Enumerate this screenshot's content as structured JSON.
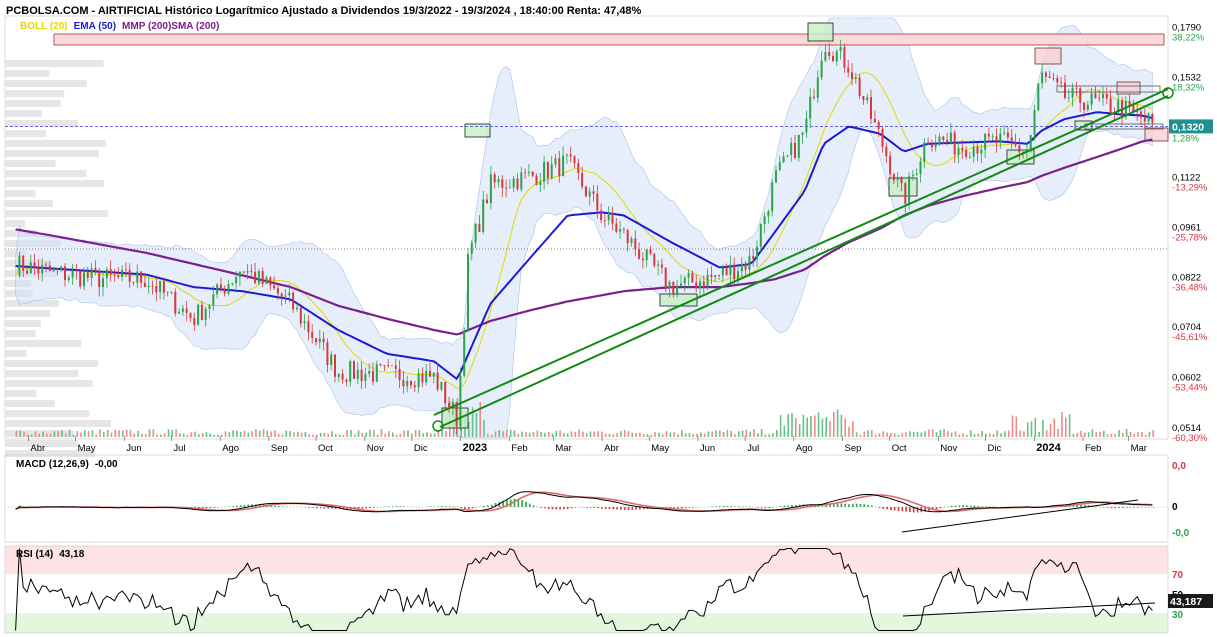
{
  "header": {
    "title": "PCBOLSA.COM - AIRTIFICIAL Histórico Logarítmico Ajustado a Dividendos 19/3/2022 - 19/3/2024 , 18:40:00 Renta: 47,48%"
  },
  "legend": {
    "boll": "BOLL (20)",
    "ema": "EMA (50)",
    "mmp_sma": "MMP (200)SMA (200)",
    "colors": {
      "boll": "#e3d800",
      "ema": "#1b1bd6",
      "mmp": "#7a1f8c",
      "sma": "#7a1f8c"
    }
  },
  "price_axis": {
    "labels": [
      {
        "price": "0,1790",
        "pct": "38,22%"
      },
      {
        "price": "0,1532",
        "pct": "18,32%"
      },
      {
        "price": "0,1122",
        "pct": "-13,29%"
      },
      {
        "price": "0,0961",
        "pct": "-25,78%"
      },
      {
        "price": "0,0822",
        "pct": "-36,48%"
      },
      {
        "price": "0,0704",
        "pct": "-45,61%"
      },
      {
        "price": "0,0602",
        "pct": "-53,44%"
      },
      {
        "price": "0,0514",
        "pct": "-60,30%"
      }
    ],
    "current_price": "0,1320",
    "current_pct_partial": "1,28%"
  },
  "months": [
    {
      "label": "Abr",
      "bold": false
    },
    {
      "label": "May",
      "bold": false
    },
    {
      "label": "Jun",
      "bold": false
    },
    {
      "label": "Jul",
      "bold": false
    },
    {
      "label": "Ago",
      "bold": false
    },
    {
      "label": "Sep",
      "bold": false
    },
    {
      "label": "Oct",
      "bold": false
    },
    {
      "label": "Nov",
      "bold": false
    },
    {
      "label": "Dic",
      "bold": false
    },
    {
      "label": "2023",
      "bold": true
    },
    {
      "label": "Feb",
      "bold": false
    },
    {
      "label": "Mar",
      "bold": false
    },
    {
      "label": "Abr",
      "bold": false
    },
    {
      "label": "May",
      "bold": false
    },
    {
      "label": "Jun",
      "bold": false
    },
    {
      "label": "Jul",
      "bold": false
    },
    {
      "label": "Ago",
      "bold": false
    },
    {
      "label": "Sep",
      "bold": false
    },
    {
      "label": "Oct",
      "bold": false
    },
    {
      "label": "Nov",
      "bold": false
    },
    {
      "label": "Dic",
      "bold": false
    },
    {
      "label": "2024",
      "bold": true
    },
    {
      "label": "Feb",
      "bold": false
    },
    {
      "label": "Mar",
      "bold": false
    }
  ],
  "macd": {
    "title": "MACD (12,26,9)",
    "value": "-0,00",
    "axis": [
      "0,0",
      "0",
      "-0,0"
    ]
  },
  "rsi": {
    "title": "RSI (14)",
    "value": "43,18",
    "axis": [
      "70",
      "50",
      "30"
    ],
    "current": "43,187"
  },
  "chart_data": {
    "type": "line",
    "scale": "log",
    "x": [
      "2022-03-21",
      "2022-04-15",
      "2022-05-15",
      "2022-06-15",
      "2022-07-15",
      "2022-08-15",
      "2022-09-15",
      "2022-10-15",
      "2022-11-15",
      "2022-12-15",
      "2022-12-30",
      "2023-01-06",
      "2023-01-20",
      "2023-02-15",
      "2023-03-10",
      "2023-04-01",
      "2023-04-15",
      "2023-05-15",
      "2023-06-15",
      "2023-07-05",
      "2023-07-20",
      "2023-08-08",
      "2023-08-20",
      "2023-09-05",
      "2023-09-25",
      "2023-10-10",
      "2023-10-25",
      "2023-11-15",
      "2023-12-10",
      "2023-12-28",
      "2024-01-05",
      "2024-01-20",
      "2024-02-10",
      "2024-02-25",
      "2024-03-10",
      "2024-03-19"
    ],
    "series": [
      {
        "name": "",
        "values": [
          0.0862,
          0.0838,
          0.0822,
          0.082,
          0.0725,
          0.085,
          0.076,
          0.0615,
          0.061,
          0.0605,
          0.053,
          0.088,
          0.11,
          0.113,
          0.118,
          0.1,
          0.094,
          0.08,
          0.083,
          0.087,
          0.112,
          0.13,
          0.172,
          0.16,
          0.127,
          0.105,
          0.128,
          0.124,
          0.126,
          0.122,
          0.155,
          0.145,
          0.142,
          0.14,
          0.135,
          0.132
        ]
      },
      {
        "name": "EMA (50)",
        "values": [
          0.0855,
          0.0848,
          0.084,
          0.0832,
          0.08,
          0.079,
          0.077,
          0.07,
          0.065,
          0.0635,
          0.06,
          0.065,
          0.076,
          0.088,
          0.1,
          0.101,
          0.1,
          0.092,
          0.085,
          0.086,
          0.095,
          0.108,
          0.125,
          0.132,
          0.129,
          0.122,
          0.125,
          0.1255,
          0.126,
          0.125,
          0.13,
          0.135,
          0.138,
          0.137,
          0.1365,
          0.135
        ]
      },
      {
        "name": "MMP (200)SMA (200)",
        "values": [
          0.096,
          0.094,
          0.0915,
          0.089,
          0.086,
          0.083,
          0.08,
          0.0755,
          0.0725,
          0.07,
          0.069,
          0.07,
          0.072,
          0.0745,
          0.0765,
          0.078,
          0.079,
          0.08,
          0.08,
          0.081,
          0.082,
          0.0845,
          0.088,
          0.092,
          0.096,
          0.1,
          0.103,
          0.106,
          0.109,
          0.111,
          0.113,
          0.116,
          0.12,
          0.123,
          0.126,
          0.127
        ]
      }
    ],
    "yticks": [
      0.0514,
      0.0602,
      0.0704,
      0.0822,
      0.0961,
      0.1122,
      0.132,
      0.1532,
      0.179
    ],
    "ylim": [
      0.05,
      0.185
    ],
    "title": "",
    "xlabel": "",
    "ylabel": "",
    "grid": false
  }
}
